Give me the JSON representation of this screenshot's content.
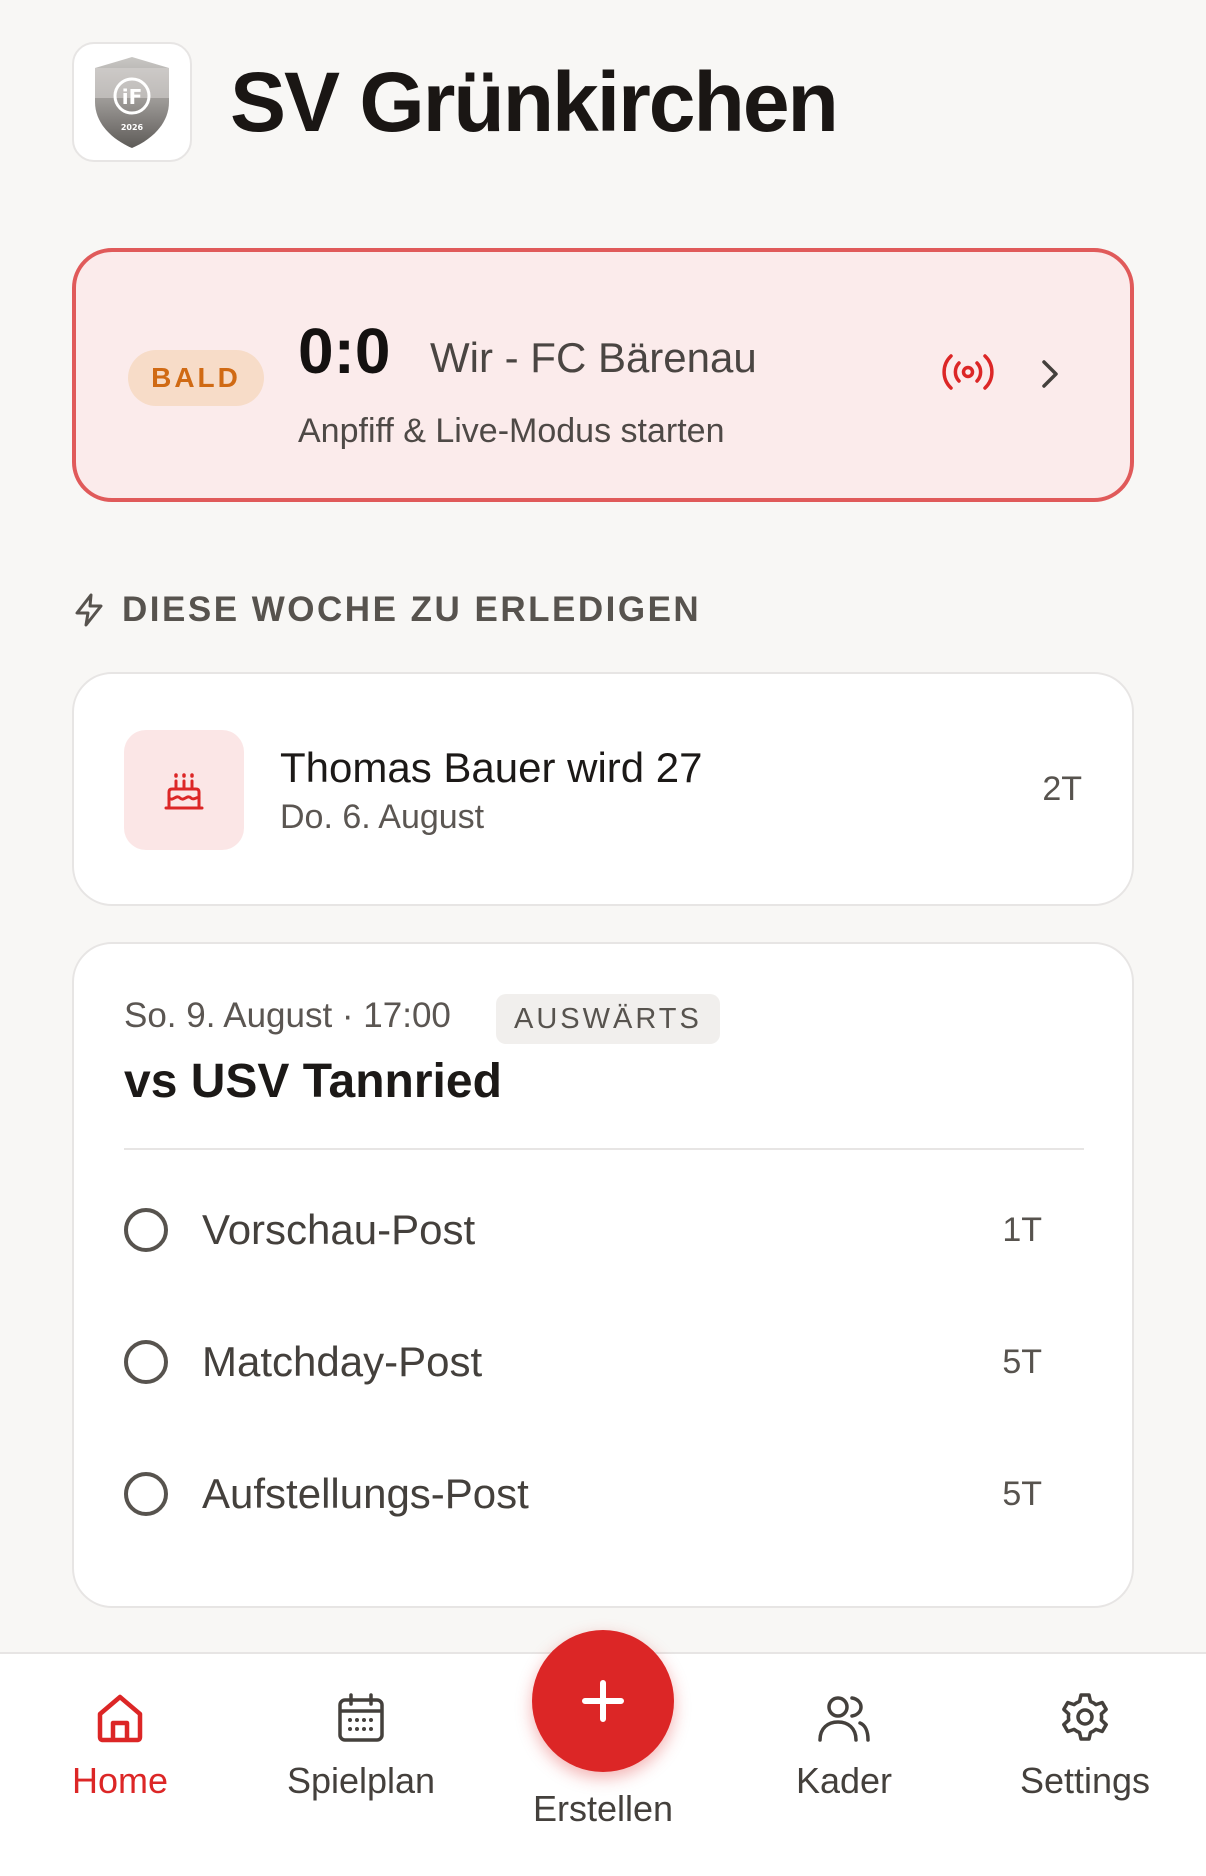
{
  "header": {
    "club_name": "SV Grünkirchen",
    "logo_text": "iF",
    "logo_year": "2026"
  },
  "live_card": {
    "badge": "BALD",
    "score": "0:0",
    "match": "Wir - FC Bärenau",
    "subtitle": "Anpfiff & Live-Modus starten"
  },
  "section": {
    "title": "DIESE WOCHE ZU ERLEDIGEN"
  },
  "birthday": {
    "title": "Thomas Bauer wird 27",
    "date": "Do. 6. August",
    "days": "2T"
  },
  "match": {
    "date": "So. 9. August · 17:00",
    "badge": "AUSWÄRTS",
    "title": "vs USV Tannried",
    "tasks": [
      {
        "label": "Vorschau-Post",
        "days": "1T"
      },
      {
        "label": "Matchday-Post",
        "days": "5T"
      },
      {
        "label": "Aufstellungs-Post",
        "days": "5T"
      }
    ]
  },
  "nav": {
    "home": "Home",
    "spielplan": "Spielplan",
    "erstellen": "Erstellen",
    "kader": "Kader",
    "settings": "Settings"
  },
  "colors": {
    "accent": "#dc2626",
    "live_bg": "#fbebeb",
    "live_border": "#e05a5a",
    "badge_bg": "#f7dcc8",
    "badge_text": "#d06a14"
  },
  "icons": {
    "logo": "club-shield-icon",
    "live": "broadcast-icon",
    "chevron": "chevron-right-icon",
    "section": "lightning-icon",
    "birthday": "cake-icon",
    "home": "home-icon",
    "spielplan": "calendar-icon",
    "erstellen": "plus-icon",
    "kader": "users-icon",
    "settings": "gear-icon"
  }
}
